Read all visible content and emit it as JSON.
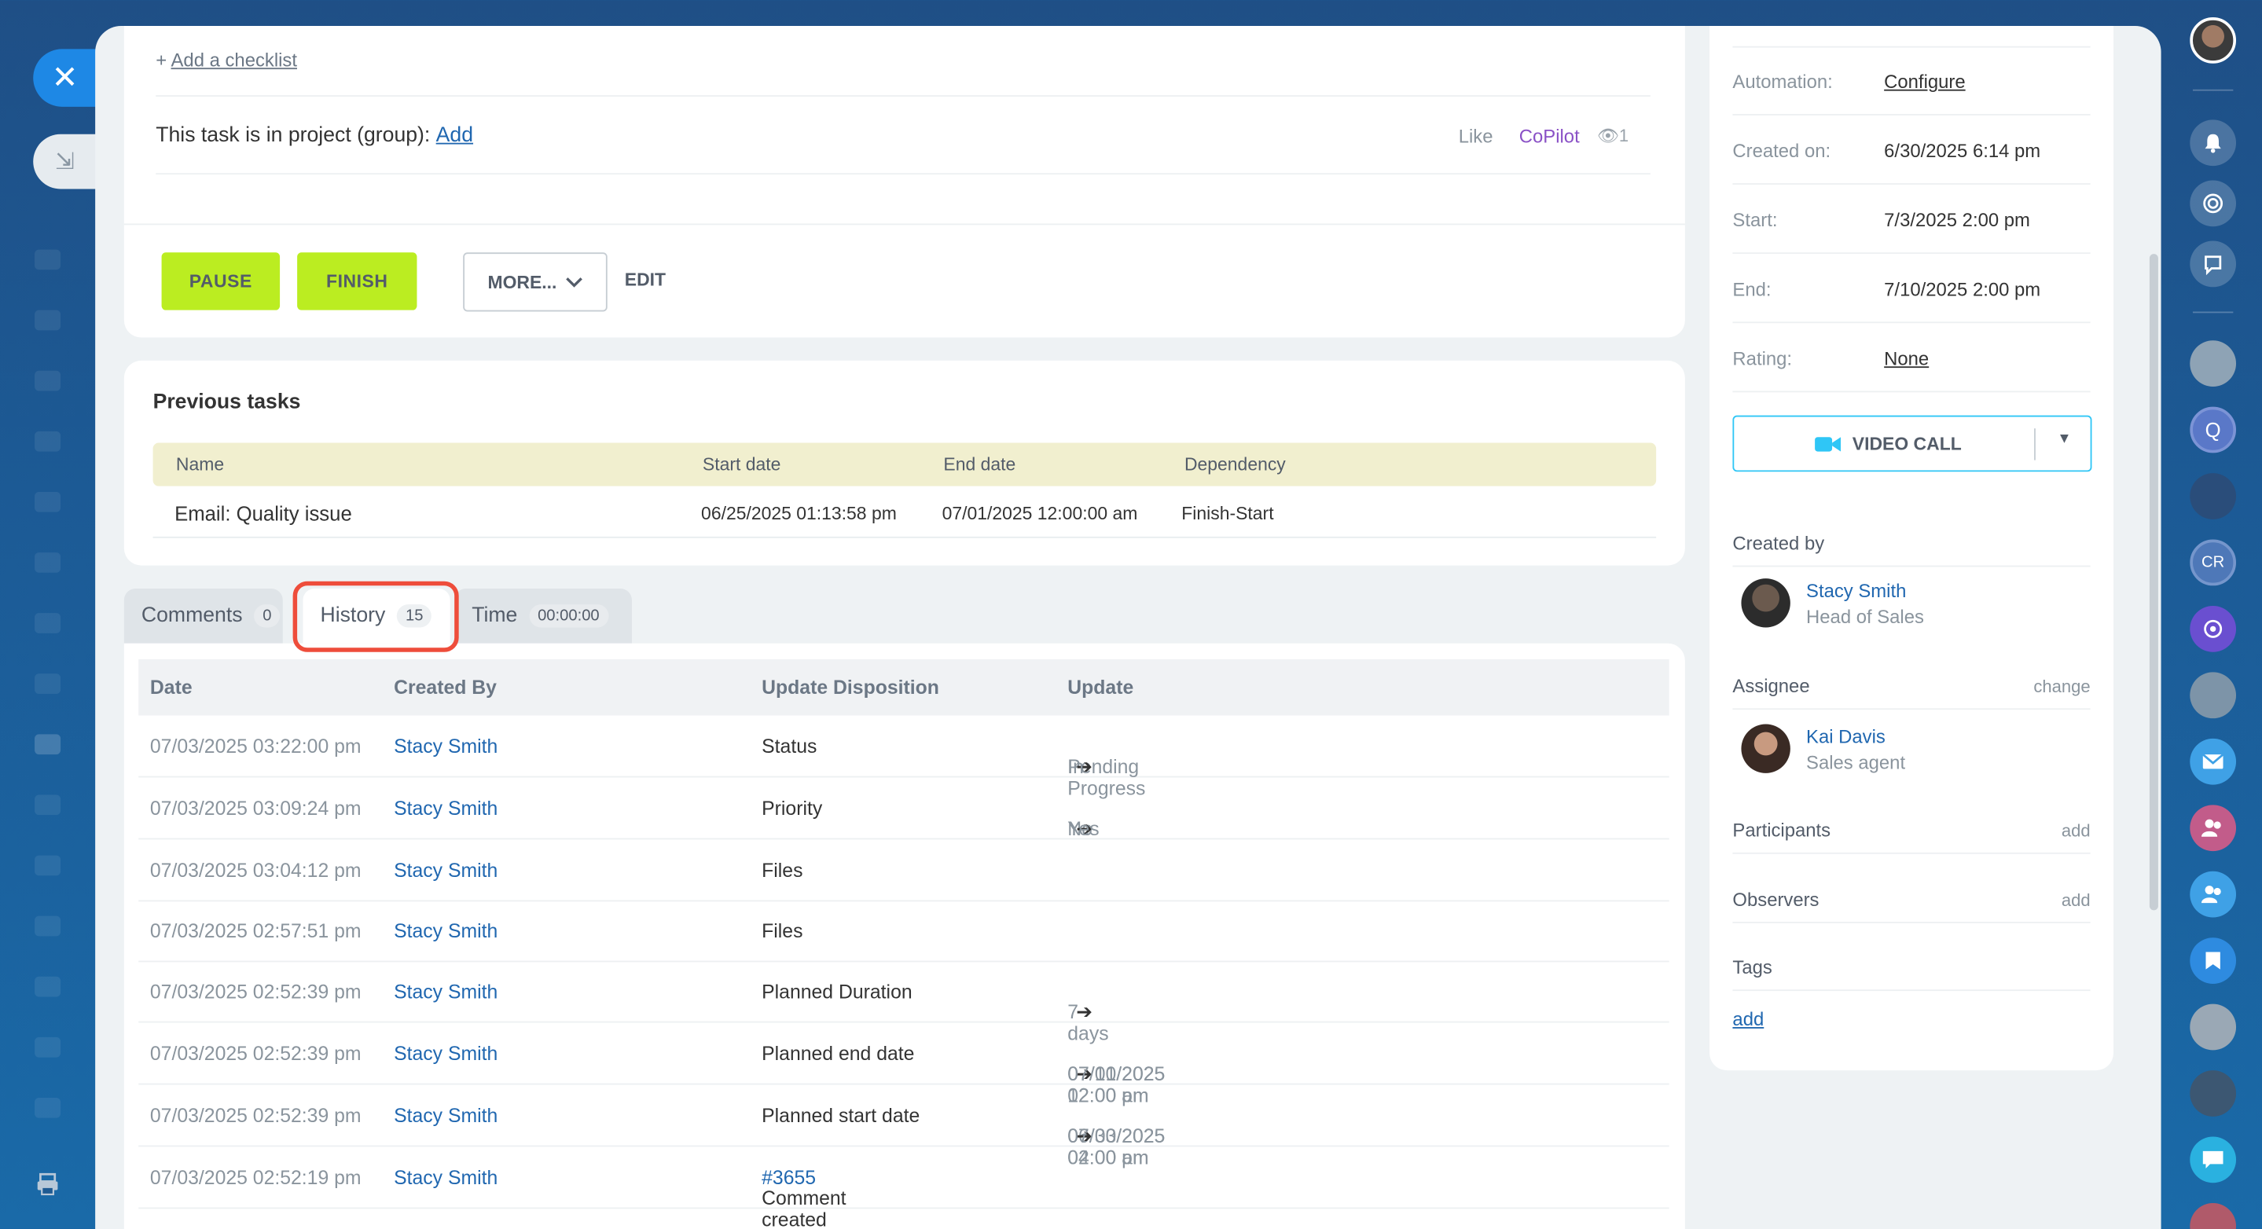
{
  "left_rail": {
    "close_label": "✕",
    "minimize_label": "⇲"
  },
  "task": {
    "add_checklist": "Add a checklist",
    "add_checklist_prefix": "+",
    "project_label": "This task is in project (group):",
    "project_add": "Add",
    "like": "Like",
    "copilot": "CoPilot",
    "views": "1"
  },
  "actions": {
    "pause": "PAUSE",
    "finish": "FINISH",
    "more": "MORE...",
    "edit": "EDIT"
  },
  "previous_tasks": {
    "title": "Previous tasks",
    "columns": [
      "Name",
      "Start date",
      "End date",
      "Dependency"
    ],
    "rows": [
      {
        "name": "Email: Quality issue",
        "start": "06/25/2025 01:13:58 pm",
        "end": "07/01/2025 12:00:00 am",
        "dependency": "Finish-Start"
      }
    ]
  },
  "tabs": [
    {
      "label": "Comments",
      "badge": "0"
    },
    {
      "label": "History",
      "badge": "15"
    },
    {
      "label": "Time",
      "badge": "00:00:00"
    }
  ],
  "history": {
    "columns": [
      "Date",
      "Created By",
      "Update Disposition",
      "Update"
    ],
    "rows": [
      {
        "date": "07/03/2025 03:22:00 pm",
        "by": "Stacy Smith",
        "disposition": "Status",
        "from": "Pending",
        "to": "In Progress",
        "link": ""
      },
      {
        "date": "07/03/2025 03:09:24 pm",
        "by": "Stacy Smith",
        "disposition": "Priority",
        "from": "No",
        "to": "Yes",
        "link": ""
      },
      {
        "date": "07/03/2025 03:04:12 pm",
        "by": "Stacy Smith",
        "disposition": "Files",
        "from": "",
        "to": "",
        "link": ""
      },
      {
        "date": "07/03/2025 02:57:51 pm",
        "by": "Stacy Smith",
        "disposition": "Files",
        "from": "",
        "to": "",
        "link": ""
      },
      {
        "date": "07/03/2025 02:52:39 pm",
        "by": "Stacy Smith",
        "disposition": "Planned Duration",
        "from": "",
        "to": "7 days",
        "link": ""
      },
      {
        "date": "07/03/2025 02:52:39 pm",
        "by": "Stacy Smith",
        "disposition": "Planned end date",
        "from": "07/01/2025 12:00 am",
        "to": "07/10/2025 02:00 pm",
        "link": ""
      },
      {
        "date": "07/03/2025 02:52:39 pm",
        "by": "Stacy Smith",
        "disposition": "Planned start date",
        "from": "06/30/2025 04:00 am",
        "to": "07/03/2025 02:00 pm",
        "link": ""
      },
      {
        "date": "07/03/2025 02:52:19 pm",
        "by": "Stacy Smith",
        "disposition": "Comment created",
        "from": "",
        "to": "",
        "link": "#3655"
      }
    ]
  },
  "sidebar": {
    "fields": [
      {
        "key": "Automation:",
        "value": "Configure",
        "underline": true
      },
      {
        "key": "Created on:",
        "value": "6/30/2025 6:14 pm",
        "underline": false
      },
      {
        "key": "Start:",
        "value": "7/3/2025 2:00 pm",
        "underline": false
      },
      {
        "key": "End:",
        "value": "7/10/2025 2:00 pm",
        "underline": false
      },
      {
        "key": "Rating:",
        "value": "None",
        "underline": true
      }
    ],
    "video_call": "VIDEO CALL",
    "created_by_label": "Created by",
    "creator": {
      "name": "Stacy Smith",
      "role": "Head of Sales"
    },
    "assignee_label": "Assignee",
    "assignee_change": "change",
    "assignee": {
      "name": "Kai Davis",
      "role": "Sales agent"
    },
    "participants_label": "Participants",
    "participants_add": "add",
    "observers_label": "Observers",
    "observers_add": "add",
    "tags_label": "Tags",
    "tags_add": "add"
  },
  "right_rail": {
    "icons": [
      "user-avatar-icon",
      "bell-icon",
      "target-icon",
      "chat-refresh-icon",
      "contact-avatar-icon",
      "q-avatar-icon",
      "contact-avatar-icon",
      "cr-avatar-icon",
      "copilot-icon",
      "group-avatar-icon",
      "mail-icon",
      "group-icon",
      "group-icon",
      "bookmark-icon",
      "contact-avatar-icon",
      "contact-avatar-icon",
      "messages-icon"
    ],
    "q_label": "Q",
    "cr_label": "CR"
  },
  "colors": {
    "accent_green": "#bbed21",
    "link_blue": "#2067b0",
    "copilot_purple": "#8a51c6",
    "highlight_red": "#ee4d3b",
    "video_border": "#2fc6f6"
  }
}
